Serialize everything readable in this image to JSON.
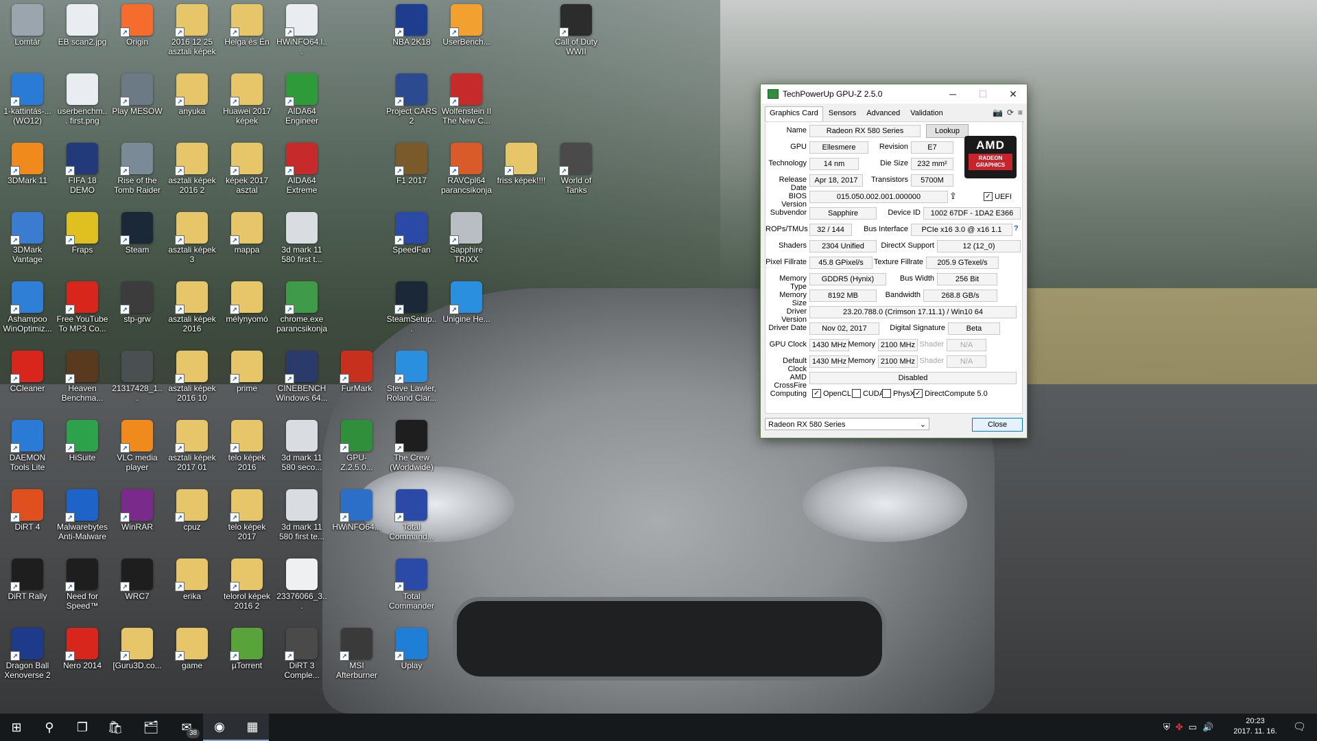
{
  "desktop_icons": [
    {
      "label": "Lomtár",
      "icon": "recycle-bin-icon",
      "color": "#9aa5ad",
      "shortcut": false
    },
    {
      "label": "EB scan2.jpg",
      "icon": "image-file-icon",
      "color": "#e9edf1",
      "shortcut": false
    },
    {
      "label": "Origin",
      "icon": "origin-icon",
      "color": "#f56c2d",
      "shortcut": true
    },
    {
      "label": "2016 12 25 asztali képek",
      "icon": "folder-icon",
      "color": "#e7c66a",
      "shortcut": true
    },
    {
      "label": "Helga és Én",
      "icon": "folder-icon",
      "color": "#e7c66a",
      "shortcut": true
    },
    {
      "label": "HWiNFO64.l...",
      "icon": "file-icon",
      "color": "#e9edf1",
      "shortcut": true
    },
    {
      "label": "NBA 2K18",
      "icon": "nba-icon",
      "color": "#1e3d8f",
      "shortcut": true
    },
    {
      "label": "UserBench...",
      "icon": "userbench-icon",
      "color": "#f2a030",
      "shortcut": true
    },
    {
      "label": "Call of Duty WWII",
      "icon": "cod-icon",
      "color": "#2c2c2c",
      "shortcut": true
    },
    {
      "label": "1-kattintás-... (WO12)",
      "icon": "click-icon",
      "color": "#2a7bd6",
      "shortcut": true
    },
    {
      "label": "userbenchm... first.png",
      "icon": "image-file-icon",
      "color": "#e9edf1",
      "shortcut": false
    },
    {
      "label": "Play MESOW",
      "icon": "mesow-icon",
      "color": "#6c7a86",
      "shortcut": true
    },
    {
      "label": "anyuka",
      "icon": "folder-icon",
      "color": "#e7c66a",
      "shortcut": true
    },
    {
      "label": "Huawei 2017 képek",
      "icon": "folder-icon",
      "color": "#e7c66a",
      "shortcut": true
    },
    {
      "label": "AIDA64 Engineer",
      "icon": "aida64-icon",
      "color": "#2f9a3a",
      "shortcut": true
    },
    {
      "label": "Project CARS 2",
      "icon": "pcars-icon",
      "color": "#2b4a8f",
      "shortcut": true
    },
    {
      "label": "Wolfenstein II The New C...",
      "icon": "wolfenstein-icon",
      "color": "#c62a2a",
      "shortcut": true
    },
    {
      "label": "3DMark 11",
      "icon": "3dmark-icon",
      "color": "#f08a1c",
      "shortcut": true
    },
    {
      "label": "FIFA 18 DEMO",
      "icon": "fifa-icon",
      "color": "#233a7a",
      "shortcut": true
    },
    {
      "label": "Rise of the Tomb Raider",
      "icon": "tombraider-icon",
      "color": "#7a8a96",
      "shortcut": true
    },
    {
      "label": "asztali képek 2016 2",
      "icon": "folder-icon",
      "color": "#e7c66a",
      "shortcut": true
    },
    {
      "label": "képek 2017 asztal",
      "icon": "folder-icon",
      "color": "#e7c66a",
      "shortcut": true
    },
    {
      "label": "AIDA64 Extreme",
      "icon": "aida64-icon",
      "color": "#c62a2a",
      "shortcut": true
    },
    {
      "label": "F1 2017",
      "icon": "f1-icon",
      "color": "#7a5a2a",
      "shortcut": true
    },
    {
      "label": "RAVCpl64 parancsikonja",
      "icon": "speaker-icon",
      "color": "#d95b2a",
      "shortcut": true
    },
    {
      "label": "World of Tanks",
      "icon": "tank-icon",
      "color": "#4a4a4a",
      "shortcut": true
    },
    {
      "label": "friss képek!!!!",
      "icon": "folder-icon",
      "color": "#e7c66a",
      "shortcut": true
    },
    {
      "label": "3DMark Vantage",
      "icon": "3dmark-vantage-icon",
      "color": "#3b7bd0",
      "shortcut": true
    },
    {
      "label": "Fraps",
      "icon": "fraps-icon",
      "color": "#e0c020",
      "shortcut": true
    },
    {
      "label": "Steam",
      "icon": "steam-icon",
      "color": "#1b2838",
      "shortcut": true
    },
    {
      "label": "asztali képek 3",
      "icon": "folder-icon",
      "color": "#e7c66a",
      "shortcut": true
    },
    {
      "label": "mappa",
      "icon": "folder-icon",
      "color": "#e7c66a",
      "shortcut": true
    },
    {
      "label": "3d mark 11 580 first t...",
      "icon": "image-file-icon",
      "color": "#d9dde1",
      "shortcut": false
    },
    {
      "label": "SpeedFan",
      "icon": "speedfan-icon",
      "color": "#2b4aa8",
      "shortcut": true
    },
    {
      "label": "Sapphire TRIXX",
      "icon": "trixx-icon",
      "color": "#b9bec4",
      "shortcut": true
    },
    {
      "label": "Ashampoo WinOptimiz...",
      "icon": "gear-icon",
      "color": "#2f7fd6",
      "shortcut": true
    },
    {
      "label": "Free YouTube To MP3 Co...",
      "icon": "youtube-mp3-icon",
      "color": "#d8261d",
      "shortcut": true
    },
    {
      "label": "stp-grw",
      "icon": "skull-icon",
      "color": "#3c3c3c",
      "shortcut": true
    },
    {
      "label": "asztali képek 2016",
      "icon": "folder-icon",
      "color": "#e7c66a",
      "shortcut": true
    },
    {
      "label": "mélynyomó",
      "icon": "folder-icon",
      "color": "#e7c66a",
      "shortcut": true
    },
    {
      "label": "chrome.exe parancsikonja",
      "icon": "chrome-icon",
      "color": "#3f9b49",
      "shortcut": true
    },
    {
      "label": "SteamSetup...",
      "icon": "steam-icon",
      "color": "#1b2838",
      "shortcut": true
    },
    {
      "label": "Unigine He...",
      "icon": "ie-icon",
      "color": "#2b8fe0",
      "shortcut": true
    },
    {
      "label": "CCleaner",
      "icon": "ccleaner-icon",
      "color": "#d8261d",
      "shortcut": true
    },
    {
      "label": "Heaven Benchma...",
      "icon": "heaven-icon",
      "color": "#5a3a1e",
      "shortcut": true
    },
    {
      "label": "21317428_1...",
      "icon": "image-file-icon",
      "color": "#4a4f52",
      "shortcut": false
    },
    {
      "label": "asztali képek 2016 10",
      "icon": "folder-icon",
      "color": "#e7c66a",
      "shortcut": true
    },
    {
      "label": "prime",
      "icon": "folder-icon",
      "color": "#e7c66a",
      "shortcut": true
    },
    {
      "label": "CINEBENCH Windows 64...",
      "icon": "cinebench-icon",
      "color": "#2a3a6a",
      "shortcut": true
    },
    {
      "label": "FurMark",
      "icon": "furmark-icon",
      "color": "#c8301e",
      "shortcut": true
    },
    {
      "label": "Steve Lawler, Roland Clar...",
      "icon": "music-icon",
      "color": "#2b8fe0",
      "shortcut": true
    },
    {
      "label": "DAEMON Tools Lite",
      "icon": "daemon-icon",
      "color": "#2a7bd6",
      "shortcut": true
    },
    {
      "label": "HiSuite",
      "icon": "hisuite-icon",
      "color": "#2ca34a",
      "shortcut": true
    },
    {
      "label": "VLC media player",
      "icon": "vlc-icon",
      "color": "#f08a1c",
      "shortcut": true
    },
    {
      "label": "asztali képek 2017 01",
      "icon": "folder-icon",
      "color": "#e7c66a",
      "shortcut": true
    },
    {
      "label": "telo képek 2016",
      "icon": "folder-icon",
      "color": "#e7c66a",
      "shortcut": true
    },
    {
      "label": "3d mark 11 580 seco...",
      "icon": "image-file-icon",
      "color": "#d9dde1",
      "shortcut": false
    },
    {
      "label": "GPU-Z.2.5.0...",
      "icon": "gpuz-icon",
      "color": "#2f8f3a",
      "shortcut": true
    },
    {
      "label": "The Crew (Worldwide)",
      "icon": "thecrew-icon",
      "color": "#1e1e1e",
      "shortcut": true
    },
    {
      "label": "DiRT 4",
      "icon": "dirt4-icon",
      "color": "#e0501e",
      "shortcut": true
    },
    {
      "label": "Malwarebytes Anti-Malware",
      "icon": "malwarebytes-icon",
      "color": "#1e63c8",
      "shortcut": true
    },
    {
      "label": "WinRAR",
      "icon": "winrar-icon",
      "color": "#7a2a8a",
      "shortcut": true
    },
    {
      "label": "cpuz",
      "icon": "folder-icon",
      "color": "#e7c66a",
      "shortcut": true
    },
    {
      "label": "telo képek 2017",
      "icon": "folder-icon",
      "color": "#e7c66a",
      "shortcut": true
    },
    {
      "label": "3d mark 11 580 first te...",
      "icon": "image-file-icon",
      "color": "#d9dde1",
      "shortcut": false
    },
    {
      "label": "HWiNFO64...",
      "icon": "hwinfo-icon",
      "color": "#2b6fc8",
      "shortcut": true
    },
    {
      "label": "Total Command...",
      "icon": "totalcmd-icon",
      "color": "#2b4aa8",
      "shortcut": true
    },
    {
      "label": "DiRT Rally",
      "icon": "dirtrally-icon",
      "color": "#1e1e1e",
      "shortcut": true
    },
    {
      "label": "Need for Speed™",
      "icon": "nfs-icon",
      "color": "#1e1e1e",
      "shortcut": true
    },
    {
      "label": "WRC7",
      "icon": "wrc7-icon",
      "color": "#1e1e1e",
      "shortcut": true
    },
    {
      "label": "erika",
      "icon": "folder-icon",
      "color": "#e7c66a",
      "shortcut": true
    },
    {
      "label": "telorol képek 2016 2",
      "icon": "folder-icon",
      "color": "#e7c66a",
      "shortcut": true
    },
    {
      "label": "23376066_3...",
      "icon": "document-icon",
      "color": "#eef0f2",
      "shortcut": false
    },
    {
      "label": "Total Commander",
      "icon": "totalcmd-icon",
      "color": "#2b4aa8",
      "shortcut": true
    },
    {
      "label": "Dragon Ball Xenoverse 2",
      "icon": "dragonball-icon",
      "color": "#1e3a8a",
      "shortcut": true
    },
    {
      "label": "Nero 2014",
      "icon": "nero-icon",
      "color": "#d8261d",
      "shortcut": true
    },
    {
      "label": "[Guru3D.co...",
      "icon": "folder-icon",
      "color": "#e7c66a",
      "shortcut": true
    },
    {
      "label": "game",
      "icon": "folder-icon",
      "color": "#e7c66a",
      "shortcut": true
    },
    {
      "label": "µTorrent",
      "icon": "utorrent-icon",
      "color": "#58a33a",
      "shortcut": true
    },
    {
      "label": "DiRT 3 Comple...",
      "icon": "dirt3-icon",
      "color": "#4a4a4a",
      "shortcut": true
    },
    {
      "label": "MSI Afterburner",
      "icon": "afterburner-icon",
      "color": "#3a3a3a",
      "shortcut": true
    },
    {
      "label": "Uplay",
      "icon": "uplay-icon",
      "color": "#1f7fd6",
      "shortcut": true
    }
  ],
  "gpuz": {
    "title": "TechPowerUp GPU-Z 2.5.0",
    "window_controls": {
      "minimize": "─",
      "maximize": "☐",
      "close": "✕"
    },
    "tabs": [
      "Graphics Card",
      "Sensors",
      "Advanced",
      "Validation"
    ],
    "tool_icons": {
      "camera": "📷",
      "refresh": "⟳",
      "menu": "≡"
    },
    "labels": {
      "name": "Name",
      "gpu": "GPU",
      "revision": "Revision",
      "technology": "Technology",
      "die_size": "Die Size",
      "release_date": "Release Date",
      "transistors": "Transistors",
      "bios_version": "BIOS Version",
      "subvendor": "Subvendor",
      "device_id": "Device ID",
      "rops_tmus": "ROPs/TMUs",
      "bus_interface": "Bus Interface",
      "shaders": "Shaders",
      "directx_support": "DirectX Support",
      "pixel_fillrate": "Pixel Fillrate",
      "texture_fillrate": "Texture Fillrate",
      "memory_type": "Memory Type",
      "bus_width": "Bus Width",
      "memory_size": "Memory Size",
      "bandwidth": "Bandwidth",
      "driver_version": "Driver Version",
      "driver_date": "Driver Date",
      "digital_signature": "Digital Signature",
      "gpu_clock": "GPU Clock",
      "memory": "Memory",
      "shader": "Shader",
      "default_clock": "Default Clock",
      "amd_crossfire": "AMD CrossFire",
      "computing": "Computing"
    },
    "values": {
      "name": "Radeon RX 580 Series",
      "gpu": "Ellesmere",
      "revision": "E7",
      "technology": "14 nm",
      "die_size": "232 mm²",
      "release_date": "Apr 18, 2017",
      "transistors": "5700M",
      "bios_version": "015.050.002.001.000000",
      "subvendor": "Sapphire",
      "device_id": "1002 67DF - 1DA2 E366",
      "rops_tmus": "32 / 144",
      "bus_interface": "PCIe x16 3.0 @ x16 1.1",
      "shaders": "2304 Unified",
      "directx_support": "12 (12_0)",
      "pixel_fillrate": "45.8 GPixel/s",
      "texture_fillrate": "205.9 GTexel/s",
      "memory_type": "GDDR5 (Hynix)",
      "bus_width": "256 Bit",
      "memory_size": "8192 MB",
      "bandwidth": "268.8 GB/s",
      "driver_version": "23.20.788.0 (Crimson 17.11.1) / Win10 64",
      "driver_date": "Nov 02, 2017",
      "digital_signature": "Beta",
      "gpu_clock": "1430 MHz",
      "gpu_memory": "2100 MHz",
      "gpu_shader": "N/A",
      "default_clock": "1430 MHz",
      "default_memory": "2100 MHz",
      "default_shader": "N/A",
      "amd_crossfire": "Disabled"
    },
    "uefi": {
      "label": "UEFI",
      "checked": true
    },
    "computing": [
      {
        "label": "OpenCL",
        "checked": true
      },
      {
        "label": "CUDA",
        "checked": false
      },
      {
        "label": "PhysX",
        "checked": false
      },
      {
        "label": "DirectCompute 5.0",
        "checked": true
      }
    ],
    "lookup_button": "Lookup",
    "help_icon": "?",
    "logo": {
      "brand": "AMD",
      "sub": "RADEON GRAPHICS"
    },
    "selected_gpu": "Radeon RX 580 Series",
    "close_button": "Close"
  },
  "taskbar": {
    "buttons": [
      {
        "name": "start-button",
        "icon": "windows-icon",
        "glyph": "⊞"
      },
      {
        "name": "search-button",
        "icon": "search-icon",
        "glyph": "⚲"
      },
      {
        "name": "task-view-button",
        "icon": "task-view-icon",
        "glyph": "❐"
      },
      {
        "name": "store-button",
        "icon": "store-icon",
        "glyph": "🛍"
      },
      {
        "name": "explorer-button",
        "icon": "folder-icon",
        "glyph": "🗂"
      },
      {
        "name": "mail-button",
        "icon": "mail-icon",
        "glyph": "✉"
      },
      {
        "name": "chrome-button",
        "icon": "chrome-icon",
        "glyph": "◉"
      },
      {
        "name": "gpuz-taskbar-button",
        "icon": "gpuz-icon",
        "glyph": "▦"
      }
    ],
    "mail_badge": "38",
    "tray_glyphs": [
      "⛨",
      "✤",
      "▭",
      "🔊"
    ],
    "clock_time": "20:23",
    "clock_date": "2017. 11. 16.",
    "notification_glyph": "🗨"
  }
}
